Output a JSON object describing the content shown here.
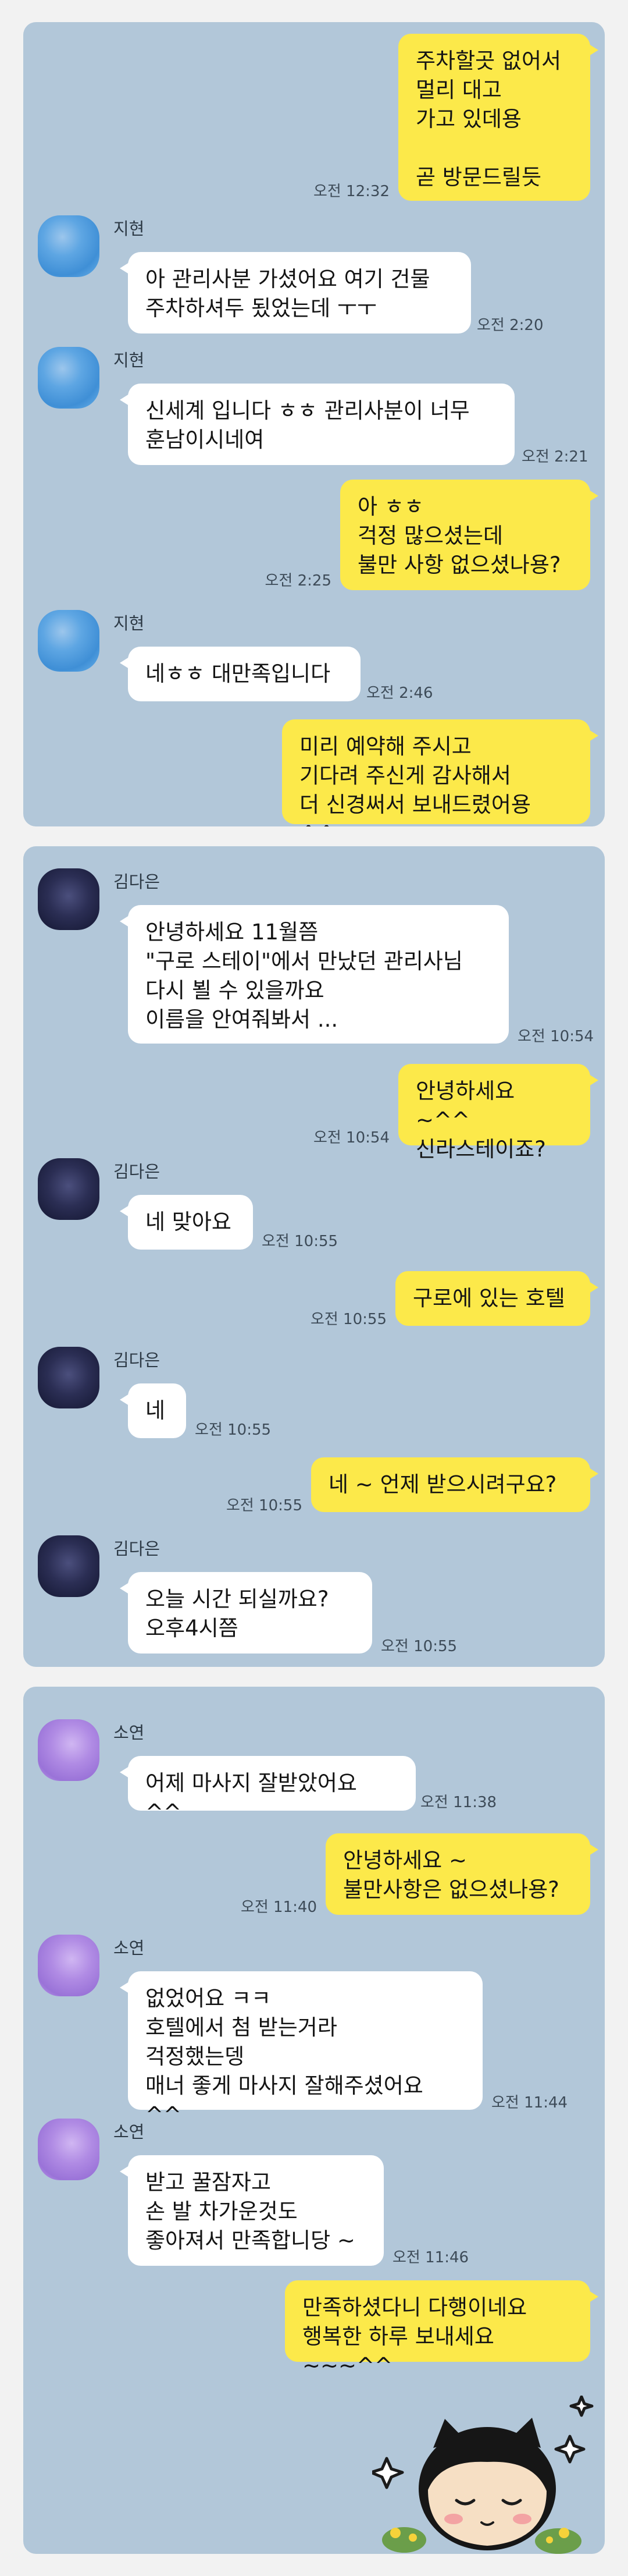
{
  "screenshots": [
    {
      "messages": [
        {
          "dir": "out",
          "text": "주차할곳 없어서\n멀리 대고\n가고 있데용\n\n곧 방문드릴듯",
          "time": "오전 12:32"
        },
        {
          "dir": "in",
          "sender": "지현",
          "text": "아 관리사분 가셨어요 여기 건물\n주차하셔두 됬었는데 ㅜㅜ",
          "time": "오전 2:20"
        },
        {
          "dir": "in",
          "sender": "지현",
          "text": "신세계 입니다 ㅎㅎ 관리사분이 너무\n훈남이시네여",
          "time": "오전 2:21"
        },
        {
          "dir": "out",
          "text": "아 ㅎㅎ\n걱정 많으셨는데\n불만 사항 없으셨나용?",
          "time": "오전 2:25"
        },
        {
          "dir": "in",
          "sender": "지현",
          "text": "네ㅎㅎ 대만족입니다",
          "time": "오전 2:46"
        },
        {
          "dir": "out",
          "text": "미리 예약해 주시고\n기다려 주신게 감사해서\n더 신경써서 보내드렸어용 ^^",
          "time": ""
        }
      ]
    },
    {
      "messages": [
        {
          "dir": "in",
          "sender": "김다은",
          "text": "안녕하세요 11월쯤\n\"구로 스테이\"에서 만났던 관리사님\n다시 뵐 수 있을까요\n이름을 안여줘봐서 ...",
          "time": "오전 10:54"
        },
        {
          "dir": "out",
          "text": "안녕하세요 ~^^\n신라스테이죠?",
          "time": "오전 10:54"
        },
        {
          "dir": "in",
          "sender": "김다은",
          "text": "네 맞아요",
          "time": "오전 10:55"
        },
        {
          "dir": "out",
          "text": "구로에 있는 호텔",
          "time": "오전 10:55"
        },
        {
          "dir": "in",
          "sender": "김다은",
          "text": "네",
          "time": "오전 10:55"
        },
        {
          "dir": "out",
          "text": "네 ~ 언제 받으시려구요?",
          "time": "오전 10:55"
        },
        {
          "dir": "in",
          "sender": "김다은",
          "text": "오늘  시간 되실까요?\n오후4시쯤",
          "time": "오전 10:55"
        }
      ]
    },
    {
      "messages": [
        {
          "dir": "in",
          "sender": "소연",
          "text": "어제 마사지 잘받았어요 ^^",
          "time": "오전 11:38"
        },
        {
          "dir": "out",
          "text": "안녕하세요 ~\n불만사항은 없으셨나용?",
          "time": "오전 11:40"
        },
        {
          "dir": "in",
          "sender": "소연",
          "text": "없었어요 ㅋㅋ\n호텔에서 첨 받는거라\n걱정했는뎅\n매너 좋게 마사지 잘해주셨어요 ^^",
          "time": "오전 11:44"
        },
        {
          "dir": "in",
          "sender": "소연",
          "text": "받고 꿀잠자고\n손 발 차가운것도\n좋아져서 만족합니당 ~",
          "time": "오전 11:46"
        },
        {
          "dir": "out",
          "text": "만족하셨다니 다행이네요\n행복한 하루 보내세요 ~~~^^",
          "time": ""
        }
      ]
    }
  ]
}
